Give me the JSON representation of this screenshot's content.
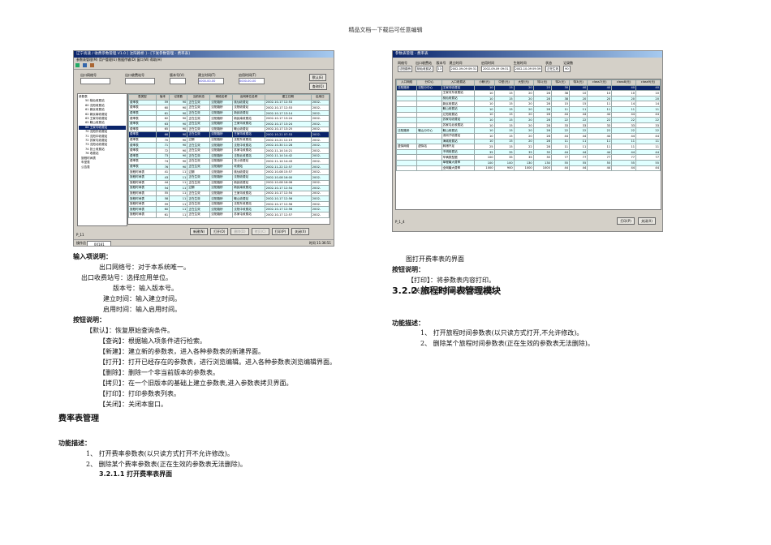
{
  "header": "精品文档---下载后可任意编辑",
  "left": {
    "input_heading": "输入项说明：",
    "inputs": [
      "出口网络号：对于本系统唯一。",
      "出口收费站号：选择应用单位。",
      "版本号：输入版本号。",
      "建立时间：输入建立时间。",
      "启用时间：输入启用时间。"
    ],
    "button_heading": "按钮说明：",
    "buttons": [
      "【默认】：恢复原始查询条件。",
      "【查询】：根据输入项条件进行检索。",
      "【新建】：建立新的参数表，进入各种参数表的新建界面。",
      "【打开】：打开已经存在的参数表，进行浏览编辑。进入各种参数表浏览编辑界面。",
      "【删除】：删除一个非当前版本的参数表。",
      "【拷贝】：在一个旧版本的基础上建立参数表,进入参数表拷贝界面。",
      "【打印】：打印参数表列表。",
      "【关闭】：关闭本窗口。"
    ],
    "section": "费率表管理",
    "func_heading": "功能描述：",
    "funcs": [
      "1、 打开费率参数表(以只读方式打开不允许修改)。",
      "2、 删除某个费率参数表(正在生效的参数表无法删除)。"
    ],
    "subsection": "3.2.1.1 打开费率表界面"
  },
  "right": {
    "caption": "图打开费率表的界面",
    "button_heading": "按钮说明：",
    "buttons": [
      "【打印】：将参数表内容打印。",
      "【关闭】：关闭本参数表的浏览。"
    ],
    "section": "3.2.2 旅程时间表管理模块",
    "func_heading": "功能描述：",
    "funcs": [
      "1、 打开旅程时间参数表(以只读方式打开,不允许修改)。",
      "2、 删除某个旅程时间参数表(正在生效的参数表无法删除)。"
    ]
  },
  "shot1": {
    "title": "辽宁高速 / 收费参数管理 V1.0 [ 沈阳路桥 ] - [下发参数管理 - 费率表]",
    "menu": "参数表管理(M)  用户管理(U)  数据传输(D)  窗口(W)  帮助(H)",
    "filters": [
      "出口网络号",
      "出口收费站号",
      "版本号(V)",
      "建立时间(T)",
      "启用时间(T)"
    ],
    "dates": [
      "0000-00-00",
      "0000-00-00"
    ],
    "side_buttons": [
      "默认(E)",
      "查询(Q)"
    ],
    "tree_root": "参数表",
    "tree": [
      "50 桃仙收费站",
      "60 沈阳收费站",
      "61 新民收费站",
      "62 新民南收费站",
      "63 王家沟收费站",
      "65 鞍山收费站",
      "66 王家沟收费站",
      "70 沈阳东收费站",
      "71 沈阳中收费站",
      "72 苏家屯收费站",
      "73 沈阳北收费站",
      "74 张士收费站",
      "76 收费站"
    ],
    "tree_more": [
      "旅程时间表",
      "车型表",
      "公告表"
    ],
    "columns": [
      "表类型",
      "版本",
      "记录数",
      "当前状态",
      "网络名称",
      "出网单位名称",
      "建立日期",
      "启用日"
    ],
    "rows": [
      [
        "费率表",
        "59",
        "90",
        "正在生效",
        "沈阳路桥",
        "桃仙收费站",
        "2002-10-17 12:53",
        "2002-"
      ],
      [
        "费率表",
        "60",
        "90",
        "正在生效",
        "沈阳路桥",
        "沈阳收费站",
        "2002-10-17 12:53",
        "2002-"
      ],
      [
        "费率表",
        "61",
        "90",
        "正在生效",
        "沈阳路桥",
        "新民收费站",
        "2002-10-17 13:14",
        "2002-"
      ],
      [
        "费率表",
        "62",
        "90",
        "正在生效",
        "沈阳路桥",
        "新民南收费站",
        "2002-10-17 13:24",
        "2002-"
      ],
      [
        "费率表",
        "63",
        "90",
        "正在生效",
        "沈阳路桥",
        "王家沟收费站",
        "2002-10-17 13:24",
        "2002-"
      ],
      [
        "费率表",
        "65",
        "90",
        "正在生效",
        "沈阳路桥",
        "鞍山收费站",
        "2002-10-17 13:25",
        "2002-"
      ],
      [
        "费率表",
        "66",
        "90",
        "正在生效",
        "沈阳路桥",
        "王家沟收费站",
        "2002-10-21 07:53",
        "2002-"
      ],
      [
        "费率表",
        "70",
        "90",
        "过期",
        "沈阳路桥",
        "沈阳东收费站",
        "2002-10-21 12:19",
        "2002-"
      ],
      [
        "费率表",
        "71",
        "90",
        "正在生效",
        "沈阳路桥",
        "沈阳中收费站",
        "2002-10-30 11:28",
        "2002-"
      ],
      [
        "费率表",
        "72",
        "90",
        "正在生效",
        "沈阳路桥",
        "苏家屯收费站",
        "2002-11-14 14:21",
        "2002-"
      ],
      [
        "费率表",
        "73",
        "90",
        "正在生效",
        "沈阳路桥",
        "沈阳北收费站",
        "2002-11-14 14:42",
        "2002-"
      ],
      [
        "费率表",
        "74",
        "90",
        "正在生效",
        "沈阳路桥",
        "张士收费站",
        "2002-11-14 14:43",
        "2002-"
      ],
      [
        "费率表",
        "76",
        "90",
        "正在生效",
        "沈阳路桥",
        "收费站",
        "2002-11-22 12:57",
        "2002-"
      ],
      [
        "旅程时间表",
        "41",
        "11",
        "过期",
        "沈阳路桥",
        "桃仙收费站",
        "2002-10-08 15:57",
        "2002-"
      ],
      [
        "旅程时间表",
        "43",
        "11",
        "正在生效",
        "沈阳路桥",
        "沈阳收费站",
        "2002-10-08 16:00",
        "2002-"
      ],
      [
        "旅程时间表",
        "44",
        "11",
        "正在生效",
        "沈阳路桥",
        "新民收费站",
        "2002-10-08 16:06",
        "2002-"
      ],
      [
        "旅程时间表",
        "54",
        "11",
        "过期",
        "沈阳路桥",
        "新民南收费站",
        "2002-10-17 12:54",
        "2002-"
      ],
      [
        "旅程时间表",
        "55",
        "11",
        "正在生效",
        "沈阳路桥",
        "王家沟收费站",
        "2002-10-17 12:54",
        "2002-"
      ],
      [
        "旅程时间表",
        "58",
        "11",
        "正在生效",
        "沈阳路桥",
        "鞍山收费站",
        "2002-10-17 12:56",
        "2002-"
      ],
      [
        "旅程时间表",
        "59",
        "11",
        "正在生效",
        "沈阳路桥",
        "沈阳东收费站",
        "2002-10-17 12:56",
        "2002-"
      ],
      [
        "旅程时间表",
        "60",
        "11",
        "正在生效",
        "沈阳路桥",
        "沈阳中收费站",
        "2002-10-17 12:56",
        "2002-"
      ],
      [
        "旅程时间表",
        "61",
        "11",
        "正在生效",
        "沈阳路桥",
        "苏家屯收费站",
        "2002-10-17 12:57",
        "2002-"
      ]
    ],
    "selected_row": 6,
    "buttons": [
      "新建(N)",
      "打开(O)",
      "删除(D)",
      "拷贝(C)",
      "打印(P)",
      "关闭(X)"
    ],
    "form_id": "P_11",
    "status": [
      "操作员",
      "00181",
      "时间",
      "11:36:51"
    ]
  },
  "shot2": {
    "title": "参数表管理 - 费率表",
    "fields": [
      [
        "网络号",
        "沈阳路桥"
      ],
      [
        "出口收费站",
        "桃仙收费站"
      ],
      [
        "版本号",
        "13"
      ],
      [
        "建立时间",
        "2002-09-09 09:31"
      ],
      [
        "启用时间",
        "2002-09-09 09:31"
      ],
      [
        "生效时间",
        "2002-10-09 09:39"
      ],
      [
        "状态",
        "正在生效"
      ],
      [
        "记录数",
        "90"
      ]
    ],
    "columns": [
      "入口网络",
      "分中心",
      "入口收费站",
      "小轿(元)",
      "中型(元)",
      "大型(元)",
      "特1(元)",
      "特2(元)",
      "特3(元)",
      "class7(元)",
      "class8(元)",
      "class9(元)"
    ],
    "rows": [
      [
        "沈阳路桥",
        "沈阳分中心",
        "王家沟收费站",
        "10",
        "15",
        "20",
        "25",
        "30",
        "40",
        "40",
        "40",
        "40"
      ],
      [
        "",
        "",
        "王家沟东收费站",
        "10",
        "15",
        "20",
        "28",
        "38",
        "10",
        "10",
        "10",
        "10"
      ],
      [
        "",
        "",
        "桃仙收费站",
        "10",
        "15",
        "20",
        "28",
        "38",
        "20",
        "20",
        "20",
        "20"
      ],
      [
        "",
        "",
        "新民收费站",
        "10",
        "15",
        "20",
        "28",
        "15",
        "15",
        "11",
        "14",
        "14"
      ],
      [
        "",
        "",
        "鞍山收费站",
        "10",
        "15",
        "20",
        "28",
        "11",
        "11",
        "11",
        "11",
        "11"
      ],
      [
        "",
        "",
        "辽阳收费站",
        "10",
        "15",
        "20",
        "28",
        "44",
        "44",
        "44",
        "44",
        "44"
      ],
      [
        "",
        "",
        "苏家屯收费站",
        "10",
        "15",
        "20",
        "28",
        "22",
        "22",
        "22",
        "22",
        "22"
      ],
      [
        "",
        "",
        "苏家屯北收费站",
        "10",
        "15",
        "20",
        "28",
        "33",
        "33",
        "33",
        "33",
        "33"
      ],
      [
        "沈阳路桥",
        "鞍山分中心",
        "鞍山收费站",
        "10",
        "15",
        "20",
        "28",
        "22",
        "22",
        "22",
        "22",
        "22"
      ],
      [
        "",
        "",
        "汤岗子收费站",
        "10",
        "15",
        "20",
        "28",
        "44",
        "44",
        "44",
        "44",
        "44"
      ],
      [
        "",
        "",
        "海城收费站",
        "10",
        "15",
        "20",
        "28",
        "11",
        "11",
        "11",
        "11",
        "11"
      ],
      [
        "虚拟网络",
        "虚拟站",
        "转储不足",
        "25",
        "15",
        "22",
        "28",
        "11",
        "11",
        "11",
        "11",
        "11"
      ],
      [
        "",
        "",
        "不明收费站",
        "35",
        "35",
        "35",
        "35",
        "44",
        "44",
        "44",
        "44",
        "44"
      ],
      [
        "",
        "",
        "车辆类型据",
        "100",
        "35",
        "35",
        "35",
        "77",
        "77",
        "77",
        "77",
        "77"
      ],
      [
        "",
        "",
        "单程最大费率",
        "100",
        "100",
        "130",
        "130",
        "55",
        "55",
        "55",
        "55",
        "55"
      ],
      [
        "",
        "",
        "全网最大费率",
        "1000",
        "900",
        "1000",
        "1000",
        "44",
        "44",
        "44",
        "44",
        "44"
      ]
    ],
    "selected_row": 0,
    "form_id": "P_1_4",
    "buttons": [
      "打印(P)",
      "关闭(X)"
    ]
  }
}
